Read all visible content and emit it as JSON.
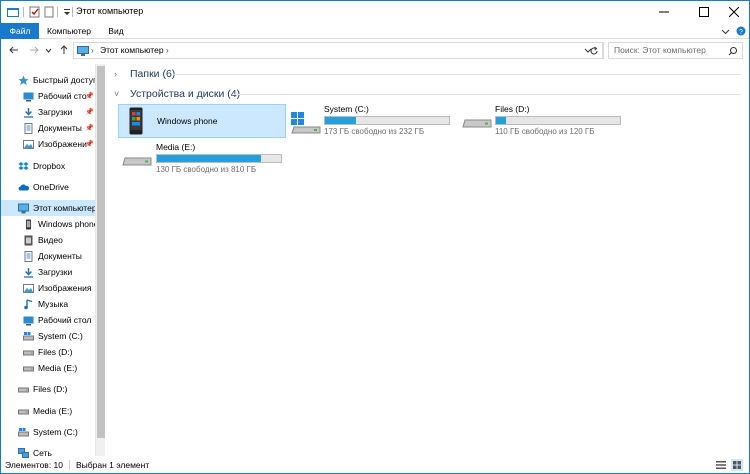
{
  "window": {
    "title": "Этот компьютер",
    "accent": "#1979ca",
    "controls": {
      "minimize": "minimize-icon",
      "maximize": "maximize-icon",
      "close": "close-icon"
    }
  },
  "ribbon": {
    "tabs": [
      {
        "label": "Файл",
        "active": true
      },
      {
        "label": "Компьютер",
        "active": false
      },
      {
        "label": "Вид",
        "active": false
      }
    ]
  },
  "address": {
    "path": "Этот компьютер",
    "search_placeholder": "Поиск: Этот компьютер"
  },
  "sidebar": {
    "items": [
      {
        "label": "Быстрый доступ",
        "icon": "star-icon",
        "pinned": false
      },
      {
        "label": "Рабочий сто",
        "icon": "desktop-folder-icon",
        "pinned": true
      },
      {
        "label": "Загрузки",
        "icon": "downloads-icon",
        "pinned": true
      },
      {
        "label": "Документы",
        "icon": "documents-icon",
        "pinned": true
      },
      {
        "label": "Изображени",
        "icon": "pictures-icon",
        "pinned": true
      },
      {
        "label": "Dropbox",
        "icon": "dropbox-icon",
        "pinned": false
      },
      {
        "label": "OneDrive",
        "icon": "onedrive-icon",
        "pinned": false
      },
      {
        "label": "Этот компьютер",
        "icon": "computer-icon",
        "selected": true
      },
      {
        "label": "Windows phone",
        "icon": "phone-icon"
      },
      {
        "label": "Видео",
        "icon": "video-icon"
      },
      {
        "label": "Документы",
        "icon": "documents-icon"
      },
      {
        "label": "Загрузки",
        "icon": "downloads-icon"
      },
      {
        "label": "Изображения",
        "icon": "pictures-icon"
      },
      {
        "label": "Музыка",
        "icon": "music-icon"
      },
      {
        "label": "Рабочий стол",
        "icon": "desktop-folder-icon"
      },
      {
        "label": "System (C:)",
        "icon": "system-drive-icon"
      },
      {
        "label": "Files (D:)",
        "icon": "drive-icon"
      },
      {
        "label": "Media (E:)",
        "icon": "drive-icon"
      },
      {
        "label": "Files (D:)",
        "icon": "drive-icon"
      },
      {
        "label": "Media (E:)",
        "icon": "drive-icon"
      },
      {
        "label": "System (C:)",
        "icon": "system-drive-icon"
      },
      {
        "label": "Сеть",
        "icon": "network-icon"
      }
    ]
  },
  "main": {
    "folders_header": "Папки (6)",
    "devices_header": "Устройства и диски (4)",
    "devices": [
      {
        "name": "Windows phone",
        "free": "",
        "fill": 0,
        "selected": true
      },
      {
        "name": "System (C:)",
        "free": "173 ГБ свободно из 232 ГБ",
        "fill": 0.254
      },
      {
        "name": "Files (D:)",
        "free": "110 ГБ свободно из 120 ГБ",
        "fill": 0.083
      },
      {
        "name": "Media (E:)",
        "free": "130 ГБ свободно из 810 ГБ",
        "fill": 0.84
      }
    ]
  },
  "status": {
    "count": "Элементов: 10",
    "selection": "Выбран 1 элемент"
  }
}
